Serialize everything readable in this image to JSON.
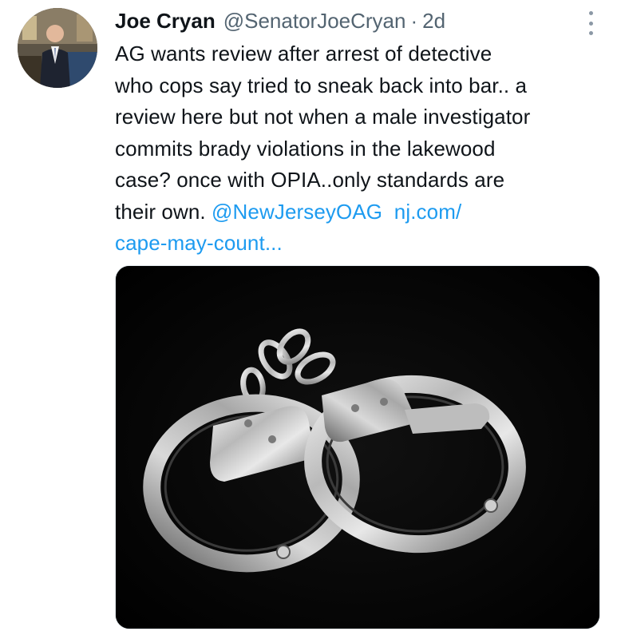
{
  "tweet": {
    "author": {
      "name": "Joe Cryan",
      "handle": "@SenatorJoeCryan",
      "separator": "·",
      "time": "2d"
    },
    "body": {
      "line1": "AG wants review after arrest of detective",
      "line2": "who cops say tried to sneak back into bar.. a",
      "line3": "review here but not when a male investigator",
      "line4": "commits brady violations  in the lakewood",
      "line5": "case?  once with OPIA..only standards are",
      "line6_text": "their own. ",
      "mention": "@NewJerseyOAG",
      "url_part1": "nj.com/",
      "url_part2": "cape-may-count..."
    },
    "media": {
      "subject": "handcuffs-photo"
    },
    "colors": {
      "link": "#1d9bf0",
      "secondary_text": "#536471",
      "text": "#0f1419"
    }
  }
}
